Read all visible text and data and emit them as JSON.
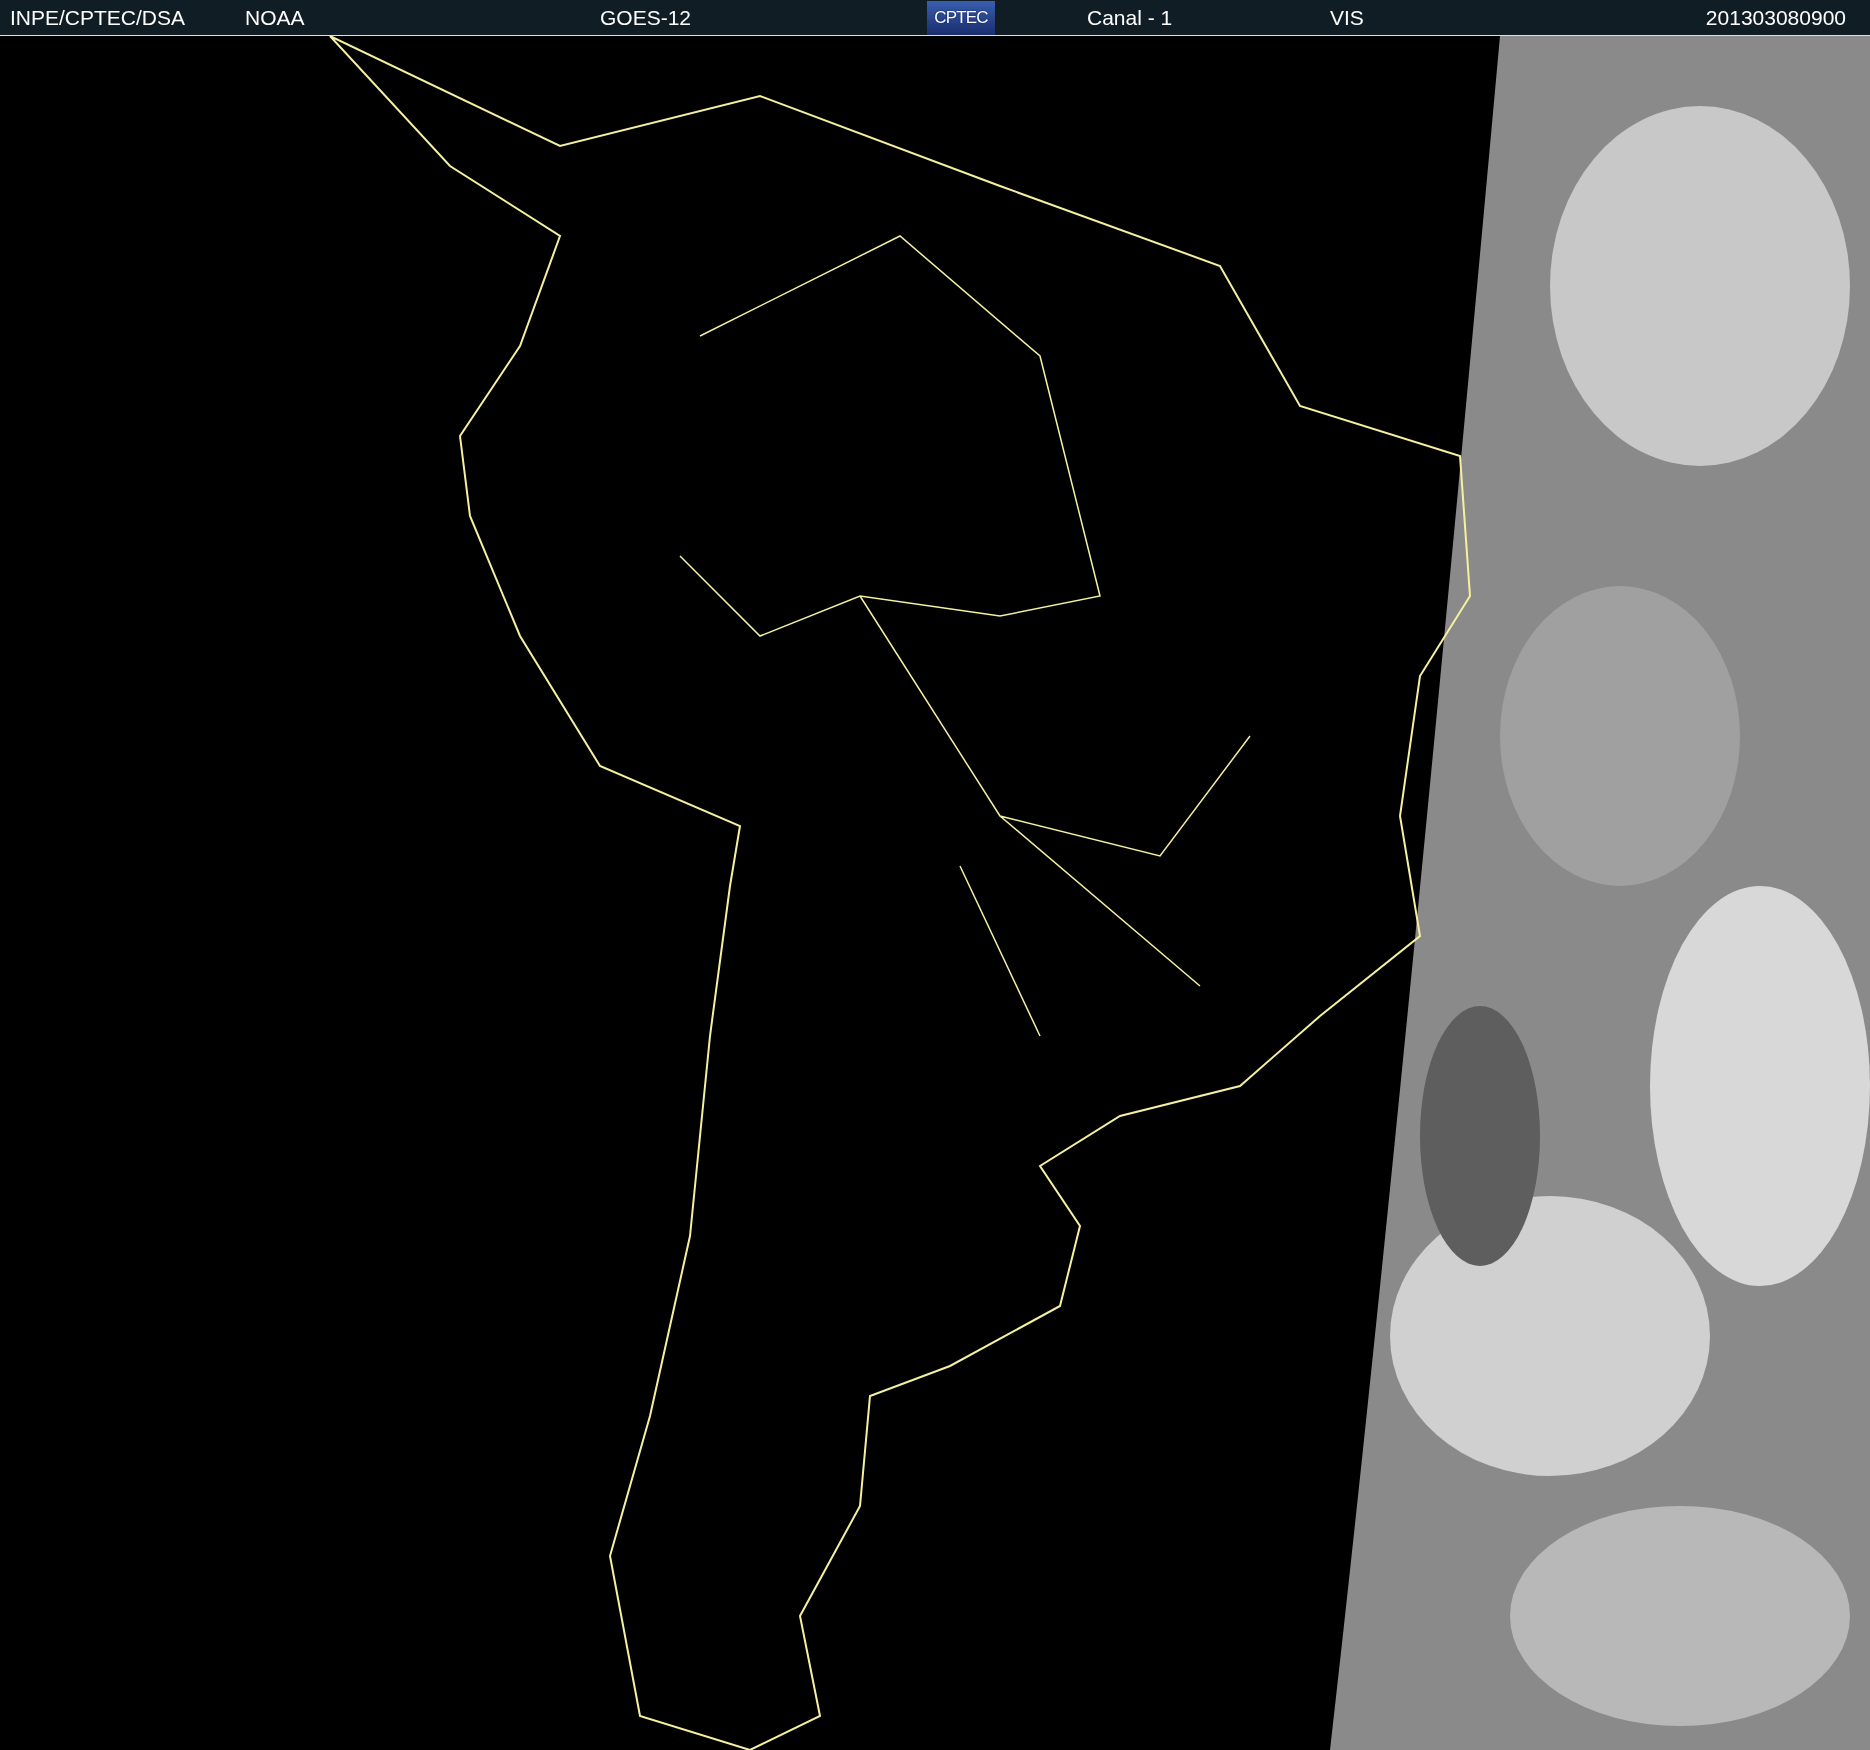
{
  "header": {
    "items": [
      {
        "kind": "text",
        "text": "INPE/CPTEC/DSA"
      },
      {
        "kind": "text",
        "text": "NOAA"
      },
      {
        "kind": "text",
        "text": "GOES-12"
      },
      {
        "kind": "logo",
        "text": "CPTEC"
      },
      {
        "kind": "text",
        "text": "Canal - 1"
      },
      {
        "kind": "text",
        "text": "VIS"
      },
      {
        "kind": "text",
        "text": "201303080900"
      }
    ]
  }
}
